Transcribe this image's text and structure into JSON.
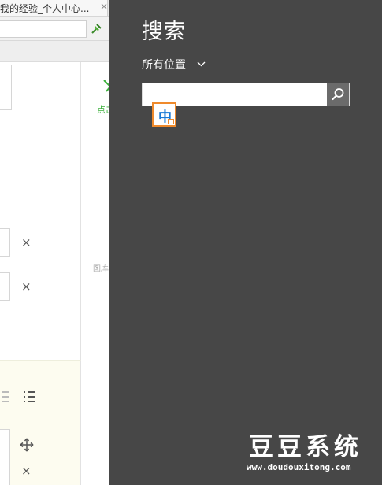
{
  "browser": {
    "tab_title": "我的经验_个人中心...",
    "tab_close": "×",
    "upload_label": "点击",
    "gallery_label": "图库",
    "remove_label": "×"
  },
  "search_charm": {
    "title": "搜索",
    "scope_label": "所有位置",
    "query": "",
    "ime_mode": "中"
  },
  "watermark": {
    "title": "豆豆系统",
    "url": "www.doudouxitong.com"
  },
  "icons": {
    "tab_close": "close-icon",
    "pin": "pin-icon",
    "upload": "upload-icon",
    "remove": "close-icon",
    "list": "list-icon",
    "move": "move-icon",
    "scope_chevron": "chevron-down-icon",
    "search": "magnifier-icon"
  },
  "colors": {
    "charm_background": "#474747",
    "search_button": "#6b6b6b",
    "ime_border": "#ef8a2c",
    "ime_text": "#1a7ad6",
    "accent_green": "#3bb03b"
  }
}
